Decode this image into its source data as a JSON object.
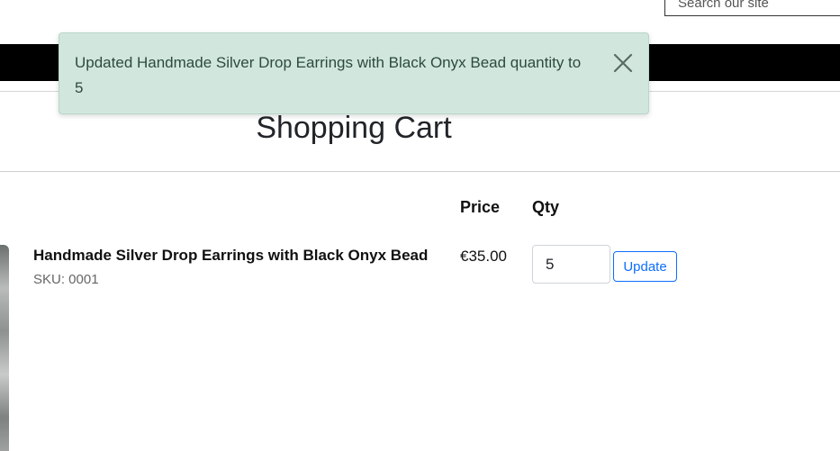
{
  "header": {
    "search_placeholder": "Search our site"
  },
  "toast": {
    "message": "Updated Handmade Silver Drop Earrings with Black Onyx Bead quantity to 5",
    "close_icon": "close-icon",
    "background_color": "#d1e7dd"
  },
  "page": {
    "title": "Shopping Cart"
  },
  "cart": {
    "columns": {
      "price": "Price",
      "qty": "Qty"
    },
    "items": [
      {
        "name": "Handmade Silver Drop Earrings with Black Onyx Bead",
        "sku": "SKU: 0001",
        "price": "€35.00",
        "qty": "5",
        "update_label": "Update"
      }
    ]
  },
  "colors": {
    "navbar": "#000000",
    "accent": "#0d6efd"
  }
}
